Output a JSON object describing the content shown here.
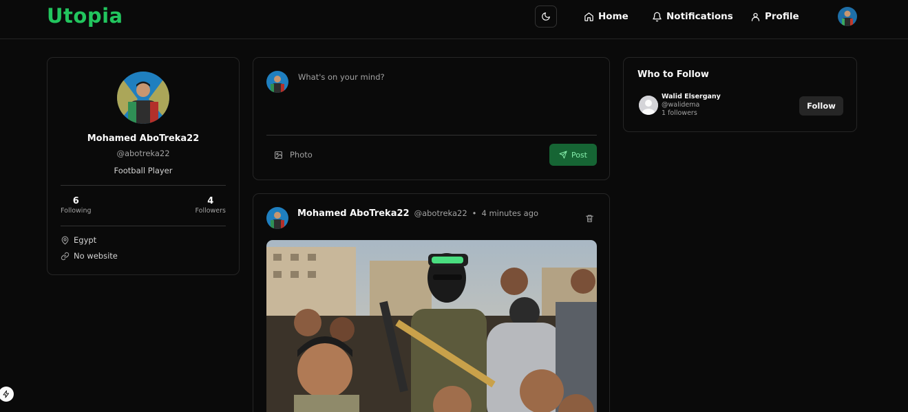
{
  "app": {
    "logo": "Utopia",
    "accent_color": "#22c55e"
  },
  "nav": {
    "theme_icon": "moon-icon",
    "items": [
      {
        "label": "Home",
        "icon": "home-icon"
      },
      {
        "label": "Notifications",
        "icon": "bell-icon"
      },
      {
        "label": "Profile",
        "icon": "user-icon"
      }
    ]
  },
  "profile": {
    "name": "Mohamed AboTreka22",
    "handle": "@abotreka22",
    "bio": "Football Player",
    "following_count": "6",
    "following_label": "Following",
    "followers_count": "4",
    "followers_label": "Followers",
    "location": "Egypt",
    "website": "No website"
  },
  "composer": {
    "placeholder": "What's on your mind?",
    "photo_label": "Photo",
    "post_label": "Post"
  },
  "post": {
    "author": "Mohamed AboTreka22",
    "handle": "@abotreka22",
    "separator": "•",
    "time": "4 minutes ago"
  },
  "who_to_follow": {
    "title": "Who to Follow",
    "users": [
      {
        "name": "Walid Elsergany",
        "handle": "@walidema",
        "followers": "1 followers",
        "button": "Follow"
      }
    ]
  }
}
